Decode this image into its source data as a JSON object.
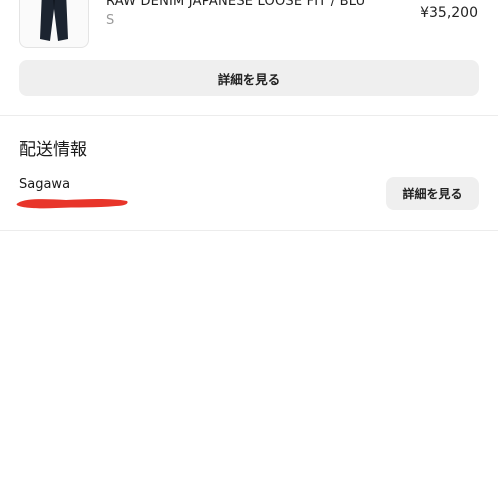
{
  "product": {
    "name": "RAW DENIM JAPANESE LOOSE FIT / BLU",
    "size": "S",
    "price": "¥35,200",
    "thumbnail_icon": "jeans-thumbnail"
  },
  "product_details_button": {
    "label": "詳細を見る"
  },
  "shipping": {
    "title": "配送情報",
    "carrier": "Sagawa",
    "details_button_label": "詳細を見る",
    "redaction_color": "#e8352a"
  },
  "colors": {
    "button_bg": "#efefef",
    "divider": "#ececec",
    "muted_text": "#9a9a9a"
  }
}
